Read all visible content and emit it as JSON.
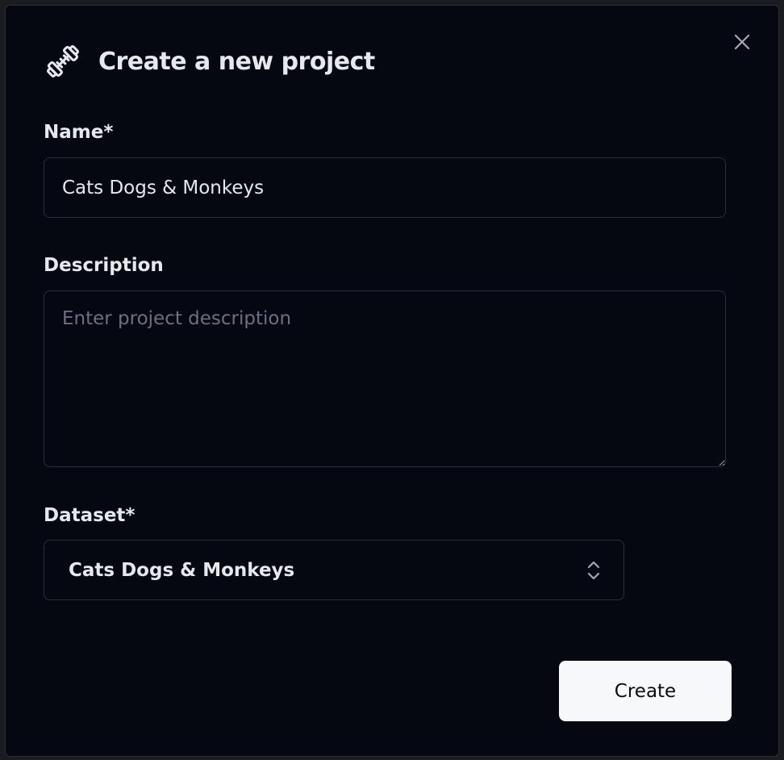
{
  "dialog": {
    "title": "Create a new project",
    "logo_icon": "dumbbell-icon",
    "close_icon": "close-icon"
  },
  "form": {
    "name_label": "Name*",
    "name_value": "Cats Dogs & Monkeys",
    "description_label": "Description",
    "description_placeholder": "Enter project description",
    "description_value": "",
    "dataset_label": "Dataset*",
    "dataset_value": "Cats Dogs & Monkeys",
    "dataset_icon": "chevron-up-down-icon"
  },
  "actions": {
    "create_label": "Create"
  },
  "colors": {
    "background": "#050810",
    "border": "#2c303a",
    "text": "#e6e8ee",
    "placeholder": "#6b7180",
    "button_bg": "#f7f8fa"
  }
}
